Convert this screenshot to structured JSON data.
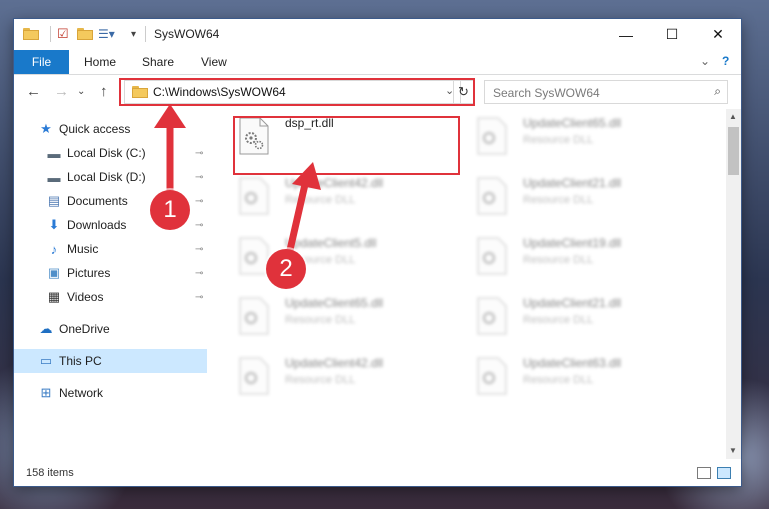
{
  "window": {
    "title": "SysWOW64",
    "minimize": "—",
    "maximize": "☐",
    "close": "✕"
  },
  "ribbon": {
    "tabs": [
      "File",
      "Home",
      "Share",
      "View"
    ],
    "expand": "⌄",
    "help": "?"
  },
  "address": {
    "path": "C:\\Windows\\SysWOW64",
    "dropdown": "⌄",
    "refresh": "↻"
  },
  "search": {
    "placeholder": "Search SysWOW64",
    "icon": "⌕"
  },
  "nav": {
    "back": "←",
    "forward": "→",
    "recent": "⌄",
    "up": "↑"
  },
  "sidebar": {
    "items": [
      {
        "label": "Quick access",
        "icon": "star-icon",
        "glyph": "★",
        "color": "#2b7bd6",
        "pinned": false
      },
      {
        "label": "Local Disk (C:)",
        "icon": "drive-icon",
        "glyph": "▬",
        "color": "#5a6b7a",
        "pinned": true
      },
      {
        "label": "Local Disk (D:)",
        "icon": "drive-icon",
        "glyph": "▬",
        "color": "#5a6b7a",
        "pinned": true
      },
      {
        "label": "Documents",
        "icon": "documents-icon",
        "glyph": "▤",
        "color": "#4f7ab3",
        "pinned": true
      },
      {
        "label": "Downloads",
        "icon": "downloads-icon",
        "glyph": "⬇",
        "color": "#2b7bd6",
        "pinned": true
      },
      {
        "label": "Music",
        "icon": "music-icon",
        "glyph": "♪",
        "color": "#2b7bd6",
        "pinned": true
      },
      {
        "label": "Pictures",
        "icon": "pictures-icon",
        "glyph": "▣",
        "color": "#4f8fc9",
        "pinned": true
      },
      {
        "label": "Videos",
        "icon": "videos-icon",
        "glyph": "▦",
        "color": "#333333",
        "pinned": true
      },
      {
        "label": "OneDrive",
        "icon": "onedrive-icon",
        "glyph": "☁",
        "color": "#1f6fc2",
        "pinned": false
      },
      {
        "label": "This PC",
        "icon": "pc-icon",
        "glyph": "▭",
        "color": "#3a7cc4",
        "pinned": false
      },
      {
        "label": "Network",
        "icon": "network-icon",
        "glyph": "⊞",
        "color": "#3a7cc4",
        "pinned": false
      }
    ],
    "pin_glyph": "📌"
  },
  "files": [
    {
      "name": "dsp_rt.dll",
      "type": "",
      "blurred": false
    },
    {
      "name": "UpdateClient65.dll",
      "type": "Resource DLL",
      "blurred": true
    },
    {
      "name": "UpdateClient42.dll",
      "type": "Resource DLL",
      "blurred": true
    },
    {
      "name": "UpdateClient21.dll",
      "type": "Resource DLL",
      "blurred": true
    },
    {
      "name": "UpdateClient5.dll",
      "type": "Resource DLL",
      "blurred": true
    },
    {
      "name": "UpdateClient19.dll",
      "type": "Resource DLL",
      "blurred": true
    },
    {
      "name": "UpdateClient65.dll",
      "type": "Resource DLL",
      "blurred": true
    },
    {
      "name": "UpdateClient21.dll",
      "type": "Resource DLL",
      "blurred": true
    },
    {
      "name": "UpdateClient42.dll",
      "type": "Resource DLL",
      "blurred": true
    },
    {
      "name": "UpdateClient63.dll",
      "type": "Resource DLL",
      "blurred": true
    }
  ],
  "status": {
    "item_count": "158 items"
  },
  "annotations": {
    "badge_1": "1",
    "badge_2": "2",
    "color": "#e0323b"
  }
}
